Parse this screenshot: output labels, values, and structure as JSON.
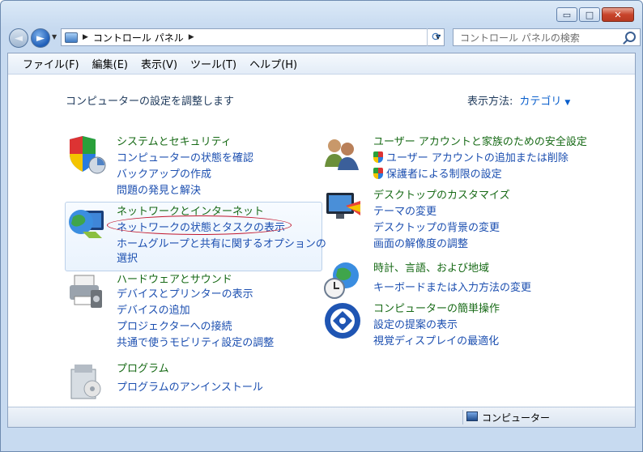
{
  "window": {
    "caption_buttons": {
      "minimize": "▭",
      "maximize": "□",
      "close": "✕"
    }
  },
  "navigation": {
    "back_glyph": "◄",
    "forward_glyph": "►",
    "breadcrumb": [
      "コントロール パネル"
    ],
    "search_placeholder": "コントロール パネルの検索"
  },
  "menubar": {
    "items": [
      "ファイル(F)",
      "編集(E)",
      "表示(V)",
      "ツール(T)",
      "ヘルプ(H)"
    ]
  },
  "content": {
    "heading": "コンピューターの設定を調整します",
    "view_by_label": "表示方法:",
    "view_by_value": "カテゴリ",
    "categories": [
      {
        "icon": "shield-system-icon",
        "title": "システムとセキュリティ",
        "links": [
          "コンピューターの状態を確認",
          "バックアップの作成",
          "問題の発見と解決"
        ]
      },
      {
        "icon": "network-globe-icon",
        "title": "ネットワークとインターネット",
        "links": [
          "ネットワークの状態とタスクの表示",
          "ホームグループと共有に関するオプションの",
          "選択"
        ]
      },
      {
        "icon": "printer-icon",
        "title": "ハードウェアとサウンド",
        "links": [
          "デバイスとプリンターの表示",
          "デバイスの追加",
          "プロジェクターへの接続",
          "共通で使うモビリティ設定の調整"
        ]
      },
      {
        "icon": "program-box-icon",
        "title": "プログラム",
        "links": [
          "プログラムのアンインストール"
        ]
      },
      {
        "icon": "users-icon",
        "title": "ユーザー アカウントと家族のための安全設定",
        "links": [
          "ユーザー アカウントの追加または削除",
          "保護者による制限の設定"
        ]
      },
      {
        "icon": "desktop-monitor-icon",
        "title": "デスクトップのカスタマイズ",
        "links": [
          "テーマの変更",
          "デスクトップの背景の変更",
          "画面の解像度の調整"
        ]
      },
      {
        "icon": "globe-clock-icon",
        "title": "時計、言語、および地域",
        "links": [
          "キーボードまたは入力方法の変更"
        ]
      },
      {
        "icon": "ease-of-access-icon",
        "title": "コンピューターの簡単操作",
        "links": [
          "設定の提案の表示",
          "視覚ディスプレイの最適化"
        ]
      }
    ]
  },
  "statusbar": {
    "label": "コンピューター"
  },
  "colors": {
    "category_title": "#176a16",
    "link": "#1c4fb0",
    "highlight_ellipse": "#c1172e"
  }
}
